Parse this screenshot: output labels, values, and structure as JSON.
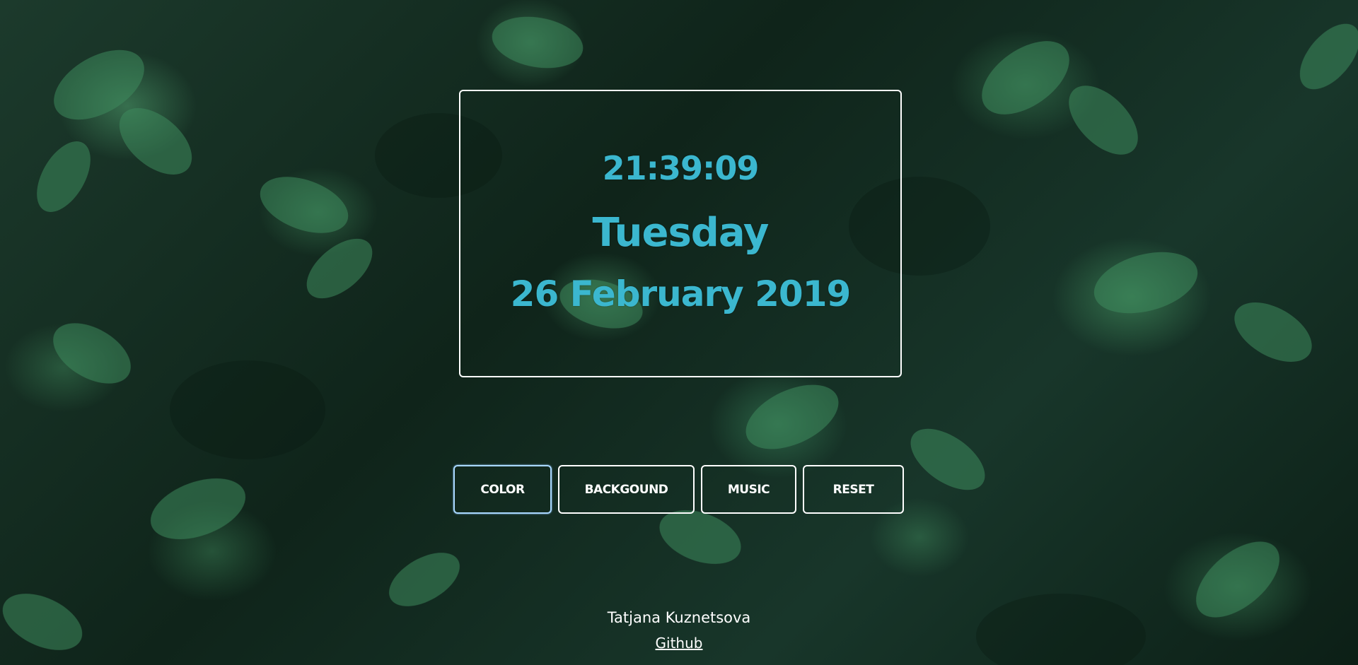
{
  "clock": {
    "time": "21:39:09",
    "weekday": "Tuesday",
    "date": "26 February 2019"
  },
  "controls": {
    "color_label": "COLOR",
    "background_label": "BACKGOUND",
    "music_label": "MUSIC",
    "reset_label": "RESET"
  },
  "footer": {
    "author": "Tatjana Kuznetsova",
    "github_label": "Github"
  },
  "colors": {
    "clock_text": "#3bb7cf",
    "border": "#ffffff",
    "background": "#1c3a2c"
  }
}
